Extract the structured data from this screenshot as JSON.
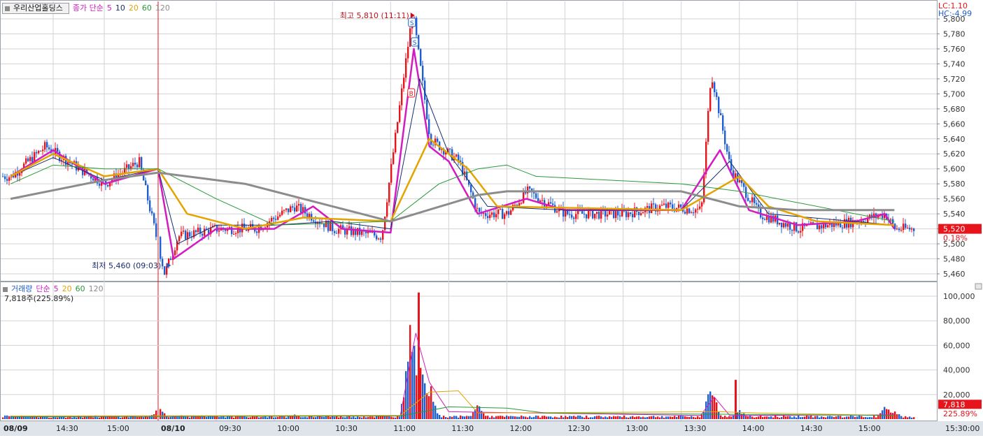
{
  "header": {
    "stock_name": "우리산업홀딩스",
    "price_legend": {
      "label": "종가 단순",
      "periods": [
        "5",
        "10",
        "20",
        "60",
        "120"
      ]
    },
    "lc_label": "LC:1.10",
    "hc_label": "HC:-4.99"
  },
  "colors": {
    "up": "#e8141b",
    "down": "#1f5fcf",
    "ma5": "#d21bc0",
    "ma10": "#1a2c6e",
    "ma20": "#e3a400",
    "ma60": "#2a9a3a",
    "ma120": "#8c8c8c",
    "grid": "#d3d3d3",
    "axis_bg": "#dfe3ea",
    "price_badge": "#e8141b"
  },
  "price_panel": {
    "y_ticks": [
      "5,460",
      "5,480",
      "5,500",
      "5,520",
      "5,540",
      "5,560",
      "5,580",
      "5,600",
      "5,620",
      "5,640",
      "5,660",
      "5,680",
      "5,700",
      "5,720",
      "5,740",
      "5,760",
      "5,780",
      "5,800"
    ],
    "high_annotation": "최고 5,810 (11:11)",
    "low_annotation": "최저 5,460 (09:03)",
    "last_price": "5,520",
    "last_change": "0.18%",
    "markers": [
      "S",
      "S",
      "B"
    ]
  },
  "volume_panel": {
    "legend_label": "거래량",
    "legend_ma": "단순",
    "periods": [
      "5",
      "20",
      "60",
      "120"
    ],
    "info": "7,818주(225.89%)",
    "y_ticks": [
      "20,000",
      "40,000",
      "60,000",
      "80,000",
      "100,000"
    ],
    "last_volume": "7,818",
    "last_ratio": "225.89%"
  },
  "x_axis": {
    "labels": [
      "08/09",
      "14:30",
      "15:00",
      "08/10",
      "09:30",
      "10:00",
      "10:30",
      "11:00",
      "11:30",
      "12:00",
      "12:30",
      "13:00",
      "13:30",
      "14:00",
      "14:30",
      "15:00",
      "15:30:00"
    ]
  },
  "chart_data": {
    "type": "candlestick",
    "title": "우리산업홀딩스",
    "ylim": [
      5450,
      5810
    ],
    "volume_ylim": [
      0,
      110000
    ],
    "sessions": [
      {
        "date": "08/09",
        "range": [
          "14:00",
          "15:30"
        ]
      },
      {
        "date": "08/10",
        "range": [
          "09:00",
          "15:30"
        ]
      }
    ],
    "price_path": [
      [
        "08/09 14:05",
        5590
      ],
      [
        "08/09 14:25",
        5630
      ],
      [
        "08/09 14:45",
        5600
      ],
      [
        "08/09 15:00",
        5580
      ],
      [
        "08/09 15:20",
        5610
      ],
      [
        "08/10 09:03",
        5460
      ],
      [
        "08/10 09:10",
        5510
      ],
      [
        "08/10 09:30",
        5520
      ],
      [
        "08/10 09:50",
        5520
      ],
      [
        "08/10 10:10",
        5550
      ],
      [
        "08/10 10:30",
        5520
      ],
      [
        "08/10 10:55",
        5510
      ],
      [
        "08/10 11:11",
        5810
      ],
      [
        "08/10 11:20",
        5640
      ],
      [
        "08/10 11:35",
        5610
      ],
      [
        "08/10 11:45",
        5540
      ],
      [
        "08/10 12:00",
        5540
      ],
      [
        "08/10 12:10",
        5570
      ],
      [
        "08/10 12:30",
        5540
      ],
      [
        "08/10 13:00",
        5540
      ],
      [
        "08/10 13:20",
        5550
      ],
      [
        "08/10 13:40",
        5545
      ],
      [
        "08/10 13:45",
        5730
      ],
      [
        "08/10 13:55",
        5600
      ],
      [
        "08/10 14:10",
        5540
      ],
      [
        "08/10 14:30",
        5520
      ],
      [
        "08/10 15:00",
        5530
      ],
      [
        "08/10 15:15",
        5540
      ],
      [
        "08/10 15:20",
        5520
      ]
    ],
    "high": {
      "price": 5810,
      "time": "11:11"
    },
    "low": {
      "price": 5460,
      "time": "09:03"
    },
    "last": {
      "price": 5520,
      "change_pct": 0.18,
      "volume": 7818,
      "volume_ratio_pct": 225.89
    },
    "moving_averages": [
      {
        "name": "5",
        "path": [
          [
            "08/09 14:05",
            5590
          ],
          [
            "08/09 14:30",
            5625
          ],
          [
            "08/09 15:00",
            5580
          ],
          [
            "08/10 09:00",
            5600
          ],
          [
            "08/10 09:08",
            5480
          ],
          [
            "08/10 09:30",
            5520
          ],
          [
            "08/10 10:00",
            5520
          ],
          [
            "08/10 10:20",
            5550
          ],
          [
            "08/10 10:35",
            5520
          ],
          [
            "08/10 11:00",
            5515
          ],
          [
            "08/10 11:12",
            5760
          ],
          [
            "08/10 11:20",
            5630
          ],
          [
            "08/10 11:30",
            5610
          ],
          [
            "08/10 11:45",
            5540
          ],
          [
            "08/10 12:10",
            5560
          ],
          [
            "08/10 12:30",
            5545
          ],
          [
            "08/10 13:30",
            5545
          ],
          [
            "08/10 13:50",
            5625
          ],
          [
            "08/10 14:05",
            5545
          ],
          [
            "08/10 14:30",
            5525
          ],
          [
            "08/10 15:00",
            5530
          ],
          [
            "08/10 15:15",
            5540
          ],
          [
            "08/10 15:20",
            5520
          ]
        ]
      },
      {
        "name": "10",
        "path": [
          [
            "08/09 14:05",
            5590
          ],
          [
            "08/09 14:30",
            5615
          ],
          [
            "08/09 15:00",
            5585
          ],
          [
            "08/10 09:00",
            5600
          ],
          [
            "08/10 09:10",
            5500
          ],
          [
            "08/10 09:30",
            5525
          ],
          [
            "08/10 10:00",
            5525
          ],
          [
            "08/10 10:30",
            5530
          ],
          [
            "08/10 11:00",
            5520
          ],
          [
            "08/10 11:15",
            5720
          ],
          [
            "08/10 11:30",
            5620
          ],
          [
            "08/10 11:50",
            5550
          ],
          [
            "08/10 12:30",
            5545
          ],
          [
            "08/10 13:30",
            5545
          ],
          [
            "08/10 13:55",
            5610
          ],
          [
            "08/10 14:15",
            5540
          ],
          [
            "08/10 15:20",
            5525
          ]
        ]
      },
      {
        "name": "20",
        "path": [
          [
            "08/09 14:05",
            5590
          ],
          [
            "08/09 14:30",
            5620
          ],
          [
            "08/09 15:00",
            5590
          ],
          [
            "08/10 09:00",
            5600
          ],
          [
            "08/10 09:15",
            5540
          ],
          [
            "08/10 09:45",
            5520
          ],
          [
            "08/10 10:15",
            5535
          ],
          [
            "08/10 11:00",
            5530
          ],
          [
            "08/10 11:20",
            5640
          ],
          [
            "08/10 11:40",
            5600
          ],
          [
            "08/10 11:55",
            5550
          ],
          [
            "08/10 13:30",
            5545
          ],
          [
            "08/10 14:00",
            5590
          ],
          [
            "08/10 14:15",
            5550
          ],
          [
            "08/10 14:40",
            5530
          ],
          [
            "08/10 15:20",
            5525
          ]
        ]
      },
      {
        "name": "60",
        "path": [
          [
            "08/09 14:05",
            5580
          ],
          [
            "08/09 14:30",
            5605
          ],
          [
            "08/09 15:00",
            5600
          ],
          [
            "08/10 09:00",
            5600
          ],
          [
            "08/10 09:30",
            5560
          ],
          [
            "08/10 10:00",
            5525
          ],
          [
            "08/10 11:00",
            5530
          ],
          [
            "08/10 11:25",
            5580
          ],
          [
            "08/10 11:45",
            5600
          ],
          [
            "08/10 12:00",
            5605
          ],
          [
            "08/10 12:15",
            5590
          ],
          [
            "08/10 13:30",
            5580
          ],
          [
            "08/10 14:00",
            5570
          ],
          [
            "08/10 15:20",
            5530
          ]
        ]
      },
      {
        "name": "120",
        "path": [
          [
            "08/09 14:05",
            5560
          ],
          [
            "08/09 15:00",
            5585
          ],
          [
            "08/10 09:00",
            5595
          ],
          [
            "08/10 09:45",
            5580
          ],
          [
            "08/10 10:30",
            5550
          ],
          [
            "08/10 11:00",
            5530
          ],
          [
            "08/10 11:45",
            5565
          ],
          [
            "08/10 12:00",
            5570
          ],
          [
            "08/10 13:30",
            5570
          ],
          [
            "08/10 14:00",
            5550
          ],
          [
            "08/10 14:30",
            5545
          ],
          [
            "08/10 15:20",
            5545
          ]
        ]
      }
    ],
    "volume_peaks": [
      [
        "08/09 14:10",
        3000
      ],
      [
        "08/10 09:00",
        12000
      ],
      [
        "08/10 09:10",
        5000
      ],
      [
        "08/10 10:10",
        4000
      ],
      [
        "08/10 11:10",
        103000
      ],
      [
        "08/10 11:15",
        70000
      ],
      [
        "08/10 11:20",
        30000
      ],
      [
        "08/10 11:45",
        14000
      ],
      [
        "08/10 13:45",
        32000
      ],
      [
        "08/10 14:00",
        8000
      ],
      [
        "08/10 15:15",
        12000
      ],
      [
        "08/10 15:20",
        7818
      ]
    ]
  }
}
